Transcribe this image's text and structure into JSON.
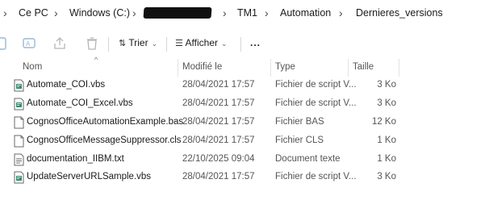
{
  "breadcrumb": [
    "Ce PC",
    "Windows (C:)",
    "TM1",
    "Automation",
    "Dernieres_versions"
  ],
  "toolbar": {
    "sort_label": "Trier",
    "view_label": "Afficher",
    "more_label": "..."
  },
  "columns": {
    "name": "Nom",
    "date": "Modifié le",
    "type": "Type",
    "size": "Taille"
  },
  "files": [
    {
      "name": "Automate_COI.vbs",
      "date": "28/04/2021 17:57",
      "type": "Fichier de script V...",
      "size": "3 Ko",
      "icon": "vbs-script-icon"
    },
    {
      "name": "Automate_COI_Excel.vbs",
      "date": "28/04/2021 17:57",
      "type": "Fichier de script V...",
      "size": "3 Ko",
      "icon": "vbs-script-icon"
    },
    {
      "name": "CognosOfficeAutomationExample.bas",
      "date": "28/04/2021 17:57",
      "type": "Fichier BAS",
      "size": "12 Ko",
      "icon": "generic-file-icon"
    },
    {
      "name": "CognosOfficeMessageSuppressor.cls",
      "date": "28/04/2021 17:57",
      "type": "Fichier CLS",
      "size": "1 Ko",
      "icon": "generic-file-icon"
    },
    {
      "name": "documentation_IIBM.txt",
      "date": "22/10/2025 09:04",
      "type": "Document texte",
      "size": "1 Ko",
      "icon": "text-document-icon"
    },
    {
      "name": "UpdateServerURLSample.vbs",
      "date": "28/04/2021 17:57",
      "type": "Fichier de script V...",
      "size": "3 Ko",
      "icon": "vbs-script-icon"
    }
  ]
}
